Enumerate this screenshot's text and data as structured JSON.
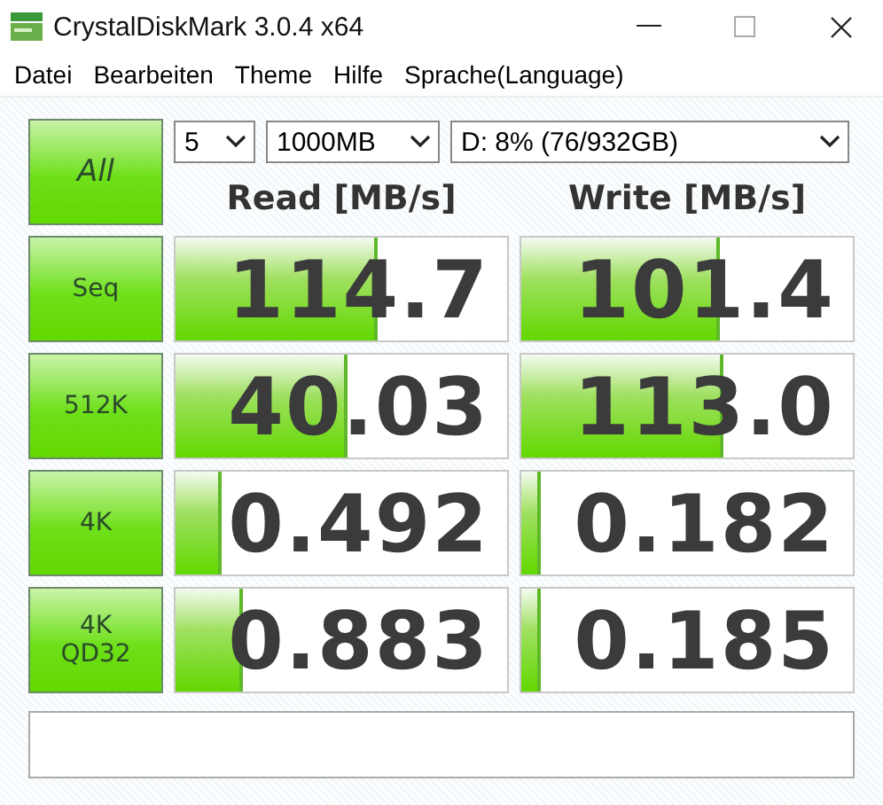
{
  "window": {
    "title": "CrystalDiskMark 3.0.4 x64"
  },
  "menu": [
    "Datei",
    "Bearbeiten",
    "Theme",
    "Hilfe",
    "Sprache(Language)"
  ],
  "all_button": "All",
  "selects": {
    "runs": "5",
    "size": "1000MB",
    "drive": "D: 8% (76/932GB)"
  },
  "headers": {
    "read": "Read [MB/s]",
    "write": "Write [MB/s]"
  },
  "rows": [
    {
      "label": [
        "Seq"
      ],
      "read": {
        "value": "114.7",
        "level": 0.6
      },
      "write": {
        "value": "101.4",
        "level": 0.59
      }
    },
    {
      "label": [
        "512K"
      ],
      "read": {
        "value": "40.03",
        "level": 0.51
      },
      "write": {
        "value": "113.0",
        "level": 0.6
      }
    },
    {
      "label": [
        "4K"
      ],
      "read": {
        "value": "0.492",
        "level": 0.13
      },
      "write": {
        "value": "0.182",
        "level": 0.05
      }
    },
    {
      "label": [
        "4K",
        "QD32"
      ],
      "read": {
        "value": "0.883",
        "level": 0.19
      },
      "write": {
        "value": "0.185",
        "level": 0.05
      }
    }
  ]
}
